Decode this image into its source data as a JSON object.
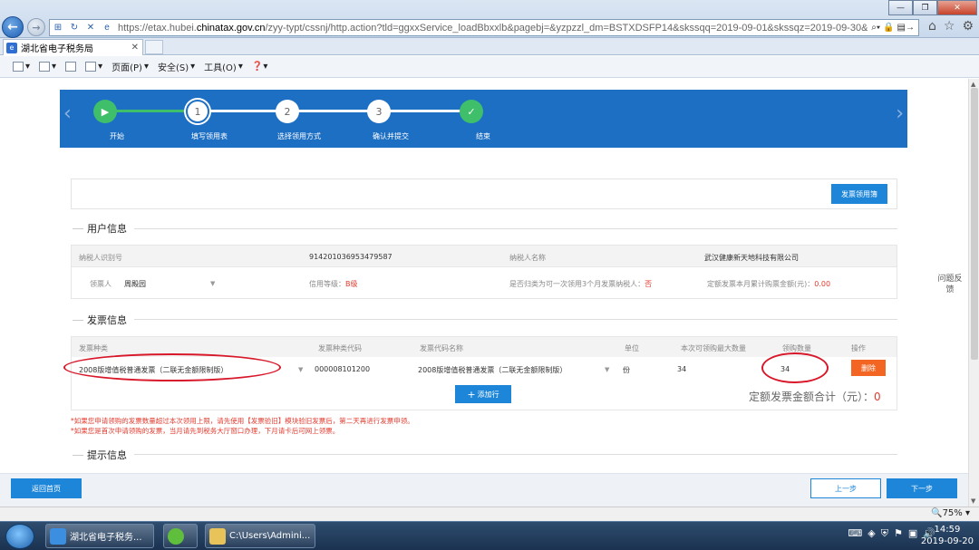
{
  "browser": {
    "url_prefix": "https://etax.hubei.",
    "url_domain": "chinatax.gov.cn",
    "url_suffix": "/zyy-typt/cssnj/http.action?tld=ggxxService_loadBbxxlb&pagebj=&yzpzzl_dm=BSTXDSFP14&skssqq=2019-09-01&skssqz=2019-09-30&gzlx_dm",
    "tab_title": "湖北省电子税务局",
    "menu": [
      "页面(P)",
      "安全(S)",
      "工具(O)"
    ],
    "zoom": "75%"
  },
  "stepper": {
    "steps": [
      {
        "label": "开始",
        "num": "▶"
      },
      {
        "label": "填写领用表",
        "num": "1"
      },
      {
        "label": "选择领用方式",
        "num": "2"
      },
      {
        "label": "确认并提交",
        "num": "3"
      },
      {
        "label": "结束",
        "num": "✓"
      }
    ]
  },
  "toolbar": {
    "record_button": "发票领用簿"
  },
  "user_info": {
    "title": "用户信息",
    "tax_id_label": "纳税人识别号",
    "tax_id_value": "914201036953479587",
    "name_label": "纳税人名称",
    "name_value": "武汉健康新天地科技有限公司",
    "receiver_label": "领票人",
    "receiver_value": "周殿园",
    "credit_label": "信用等级：",
    "credit_value": "B级",
    "monthly_label": "是否归类为可一次领用3个月发票纳税人：",
    "monthly_value": "否",
    "quota_label": "定额发票本月累计购票金额(元)：",
    "quota_value": "0.00"
  },
  "invoice_info": {
    "title": "发票信息",
    "headers": [
      "发票种类",
      "发票种类代码",
      "发票代码名称",
      "单位",
      "本次可领购最大数量",
      "领购数量",
      "操作"
    ],
    "row": {
      "type": "2008版增值税普通发票（二联无金额限制版）",
      "type_code": "000008101200",
      "code_name": "2008版增值税普通发票（二联无金额限制版）",
      "unit": "份",
      "max_qty": "34",
      "qty": "34",
      "action": "删除"
    },
    "add_row": "添加行",
    "total_label": "定额发票金额合计（元）：",
    "total_value": "0"
  },
  "notes": [
    "*如果您申请领购的发票数量超过本次领用上限，请先使用【发票验旧】模块验旧发票后，第二天再进行发票申领。",
    "*如果您是首次申请领购的发票，当月请先到税务大厅窗口办理，下月请卡后可网上领票。"
  ],
  "tips": {
    "title": "提示信息"
  },
  "side": {
    "feedback": "问题反馈"
  },
  "bottom": {
    "home": "返回首页",
    "prev": "上一步",
    "next": "下一步"
  },
  "taskbar": {
    "ie_title": "湖北省电子税务...",
    "folder_title": "C:\\Users\\Admini...",
    "time": "14:59",
    "date": "2019-09-20"
  }
}
